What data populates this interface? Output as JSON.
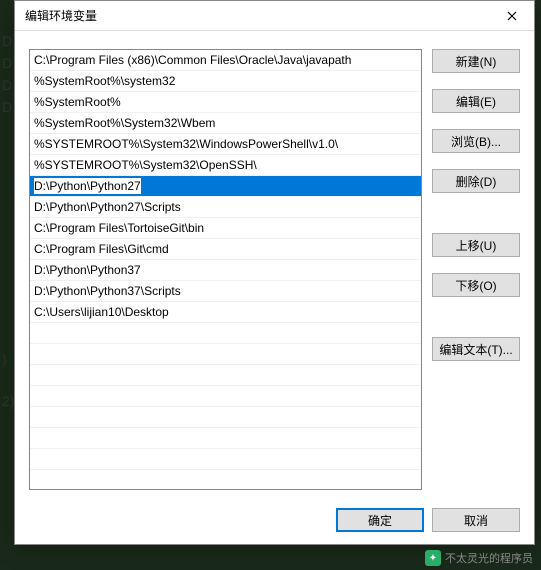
{
  "dialog": {
    "title": "编辑环境变量"
  },
  "path_entries": [
    "C:\\Program Files (x86)\\Common Files\\Oracle\\Java\\javapath",
    "%SystemRoot%\\system32",
    "%SystemRoot%",
    "%SystemRoot%\\System32\\Wbem",
    "%SYSTEMROOT%\\System32\\WindowsPowerShell\\v1.0\\",
    "%SYSTEMROOT%\\System32\\OpenSSH\\",
    "D:\\Python\\Python27",
    "D:\\Python\\Python27\\Scripts",
    "C:\\Program Files\\TortoiseGit\\bin",
    "C:\\Program Files\\Git\\cmd",
    "D:\\Python\\Python37",
    "D:\\Python\\Python37\\Scripts",
    "C:\\Users\\lijian10\\Desktop"
  ],
  "selected_index": 6,
  "buttons": {
    "new": "新建(N)",
    "edit": "编辑(E)",
    "browse": "浏览(B)...",
    "delete": "删除(D)",
    "move_up": "上移(U)",
    "move_down": "下移(O)",
    "edit_text": "编辑文本(T)...",
    "ok": "确定",
    "cancel": "取消"
  },
  "watermark": {
    "text": "不太灵光的程序员"
  },
  "bg": {
    "l1": "D",
    "l2": "D",
    "l3": "D",
    "l4": "D",
    "l5": ")",
    "l6": "2)"
  }
}
